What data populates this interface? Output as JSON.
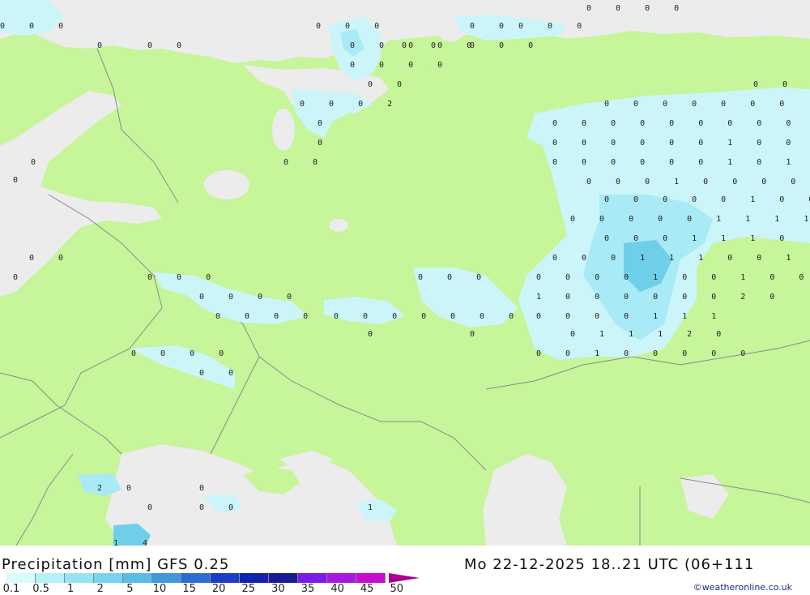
{
  "title": "Precipitation [mm] GFS 0.25",
  "valid_time": "Mo 22-12-2025 18..21 UTC (06+111",
  "credit": "©weatheronline.co.uk",
  "colors": {
    "land": "#c6f59a",
    "sea": "#ececec",
    "border": "#8a8a8a",
    "precip_light": "#ccf5fa",
    "precip_mid": "#a8eaf5",
    "precip_heavy": "#6fcfe8"
  },
  "legend": {
    "labels": [
      "0.1",
      "0.5",
      "1",
      "2",
      "5",
      "10",
      "15",
      "20",
      "25",
      "30",
      "35",
      "40",
      "45",
      "50"
    ],
    "colors": [
      "#d8fbfd",
      "#b4f0f8",
      "#96e4f2",
      "#78d4ec",
      "#58bce4",
      "#4296dc",
      "#2e6cd4",
      "#1c3ec6",
      "#1420b0",
      "#1a1a96",
      "#7a1ce8",
      "#a618e0",
      "#c60cd0",
      "#d00eb8",
      "#a8008c"
    ]
  },
  "values": [
    {
      "t": "4"
    },
    {
      "t": "0"
    },
    {
      "t": "1"
    },
    {
      "t": "0"
    },
    {
      "t": "0"
    },
    {
      "t": "1"
    },
    {
      "t": "0"
    },
    {
      "t": "0"
    },
    {
      "t": "0"
    },
    {
      "t": "0"
    },
    {
      "t": "0"
    },
    {
      "t": "1"
    },
    {
      "t": "1"
    },
    {
      "t": "1"
    },
    {
      "t": "0"
    },
    {
      "t": "0"
    },
    {
      "t": "0"
    },
    {
      "t": "0"
    },
    {
      "t": "0"
    },
    {
      "t": "0"
    },
    {
      "t": "0"
    },
    {
      "t": "1"
    },
    {
      "t": "0"
    },
    {
      "t": "0"
    },
    {
      "t": "0"
    },
    {
      "t": "0"
    },
    {
      "t": "4"
    },
    {
      "t": "0"
    },
    {
      "t": "0"
    },
    {
      "t": "0"
    },
    {
      "t": "0"
    },
    {
      "t": "1"
    },
    {
      "t": "0"
    },
    {
      "t": "0"
    },
    {
      "t": "0"
    },
    {
      "t": "1"
    },
    {
      "t": "0"
    },
    {
      "t": "0"
    },
    {
      "t": "0"
    },
    {
      "t": "0"
    },
    {
      "t": "0"
    },
    {
      "t": "0"
    },
    {
      "t": "2"
    },
    {
      "t": "0"
    },
    {
      "t": "0"
    }
  ],
  "value_rows": {
    "r1": "0 0 0 0 0 0 0",
    "r2": "0 0 0 0 0 0 0 0 0 0 0 0 0",
    "r3": "0 0 0 0 0 0 1 0 0 0 0 0 0 0 0 0",
    "r4": "0 0 0 0 0 0 1 0 1 0 0 0 0 0",
    "r5": "0 0 0 1 0 0 0 0 0 0 0",
    "r6": "0 0 0 0 0 1 0 0 0 0 0 0",
    "r7": "0 0 0 0 0 1 1 1 1 0 0 1 0 0 0",
    "r8": "0 0 0 1 1 1 0",
    "r9": "0 0 0 1 1 1 0 0 1 0",
    "r10": "0 0 0 0 1 0 0 1 0 0 0",
    "r11": "1 0 0 0 0 0 0 2 0",
    "r12": "0 0 0 0 1 1 1",
    "r13": "0 1 1 1 2 0",
    "r14": "0 0 1 0 0 0 0 0"
  },
  "west_values": {
    "w1": "0 0 0",
    "w2": "0 0 0 0 0",
    "w3": "0 0 0 0",
    "w4": "0 0 0 0",
    "w5": "0 0 0 0",
    "w6": "0 0",
    "w7": "2 0",
    "w8": "0 0",
    "w9": "0",
    "w10": "0 0 0",
    "w11": "0 0",
    "w12": "0 0 0",
    "w13": "0",
    "w14": "1",
    "w15": "1 4",
    "w16": "0 0",
    "w17": "0",
    "w18": "0",
    "w19": "0 0",
    "w20": "0 0",
    "w21": "0",
    "w22": "0",
    "w23": "0",
    "w24": "0 0",
    "w25": "0 0",
    "w26": "0 0 0 2",
    "w27": "0",
    "w28": "0",
    "w29": "0 0 0",
    "w30": "0 0 0 0",
    "w31": "0 0 0",
    "w32": "0",
    "w33": "0",
    "w34": "0 0"
  }
}
